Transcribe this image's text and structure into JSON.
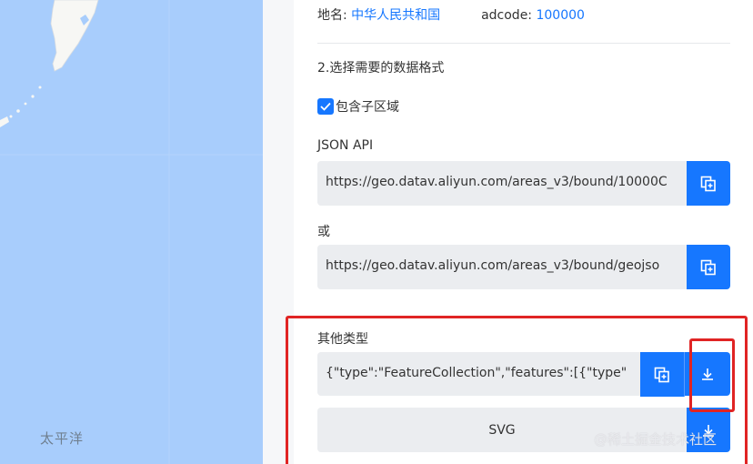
{
  "map": {
    "ocean_label": "太平洋",
    "colors": {
      "water": "#a8cdfc",
      "land": "#f7f7f4"
    }
  },
  "region": {
    "name_label": "地名:",
    "name_value": "中华人民共和国",
    "adcode_label": "adcode:",
    "adcode_value": "100000"
  },
  "step2": {
    "title": "2.选择需要的数据格式",
    "include_subregions_label": "包含子区域",
    "include_subregions_checked": true
  },
  "json_api": {
    "label": "JSON API",
    "url_full": "https://geo.datav.aliyun.com/areas_v3/bound/10000C",
    "or_label": "或",
    "url_geojson": "https://geo.datav.aliyun.com/areas_v3/bound/geojso",
    "copy_icon": "copy-icon"
  },
  "other_types": {
    "label": "其他类型",
    "geojson_preview": "{\"type\":\"FeatureCollection\",\"features\":[{\"type\"",
    "svg_label": "SVG",
    "download_icon": "download-icon"
  },
  "watermark": "@稀土掘金技术社区",
  "colors": {
    "accent": "#1677ff",
    "annotation": "#e02424",
    "field_bg": "#ebedf0"
  }
}
